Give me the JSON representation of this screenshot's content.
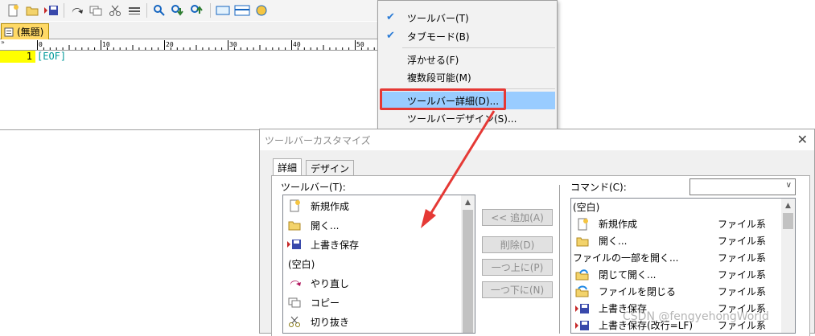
{
  "editor": {
    "tab_label": "(無題)",
    "line_number": "1",
    "eof_text": "[EOF]",
    "ruler_chevrons": "»",
    "ruler_labels": [
      "0",
      "10",
      "20",
      "30",
      "40",
      "50"
    ]
  },
  "toolbar_icons": [
    "new-icon",
    "open-icon",
    "save-icon",
    "redo-icon",
    "copy-icon",
    "cut-icon",
    "paste-icon",
    "search-icon",
    "search-next-icon",
    "search-prev-icon",
    "grep-icon",
    "outline-icon",
    "help-icon"
  ],
  "context_menu": {
    "items": [
      {
        "label": "ツールバー(T)",
        "checked": true
      },
      {
        "label": "タブモード(B)",
        "checked": true
      },
      {
        "label": "浮かせる(F)",
        "checked": false
      },
      {
        "label": "複数段可能(M)",
        "checked": false
      },
      {
        "label": "ツールバー詳細(D)...",
        "checked": false,
        "highlighted": true
      },
      {
        "label": "ツールバーデザイン(S)...",
        "checked": false
      }
    ]
  },
  "dialog": {
    "title": "ツールバーカスタマイズ",
    "close_glyph": "✕",
    "tabs": [
      "詳細",
      "デザイン"
    ],
    "toolbar_label": "ツールバー(T):",
    "toolbar_items": [
      {
        "label": "新規作成",
        "icon": "new-file-icon"
      },
      {
        "label": "開く...",
        "icon": "folder-icon"
      },
      {
        "label": "上書き保存",
        "icon": "save-icon"
      },
      {
        "label": "(空白)",
        "icon": ""
      },
      {
        "label": "やり直し",
        "icon": "redo-icon"
      },
      {
        "label": "コピー",
        "icon": "copy-icon"
      },
      {
        "label": "切り抜き",
        "icon": "scissors-icon"
      }
    ],
    "buttons": {
      "add": "<< 追加(A)",
      "delete": "削除(D)",
      "up": "一つ上に(P)",
      "down": "一つ下に(N)"
    },
    "command_label": "コマンド(C):",
    "combo_value": "",
    "commands": [
      {
        "label": "(空白)",
        "category": "",
        "icon": ""
      },
      {
        "label": "新規作成",
        "category": "ファイル系",
        "icon": "new-file-icon"
      },
      {
        "label": "開く...",
        "category": "ファイル系",
        "icon": "folder-icon"
      },
      {
        "label": "ファイルの一部を開く...",
        "category": "ファイル系",
        "icon": ""
      },
      {
        "label": "閉じて開く...",
        "category": "ファイル系",
        "icon": "close-open-icon"
      },
      {
        "label": "ファイルを閉じる",
        "category": "ファイル系",
        "icon": "close-file-icon"
      },
      {
        "label": "上書き保存",
        "category": "ファイル系",
        "icon": "save-icon"
      },
      {
        "label": "上書き保存(改行=LF)",
        "category": "ファイル系",
        "icon": "save-lf-icon"
      }
    ]
  },
  "watermark": "CSDN @fengyehongWorld",
  "colors": {
    "highlight_red": "#e53935",
    "menu_selection": "#99ccff",
    "gutter_yellow": "#ffff00",
    "eof_teal": "#009999"
  }
}
